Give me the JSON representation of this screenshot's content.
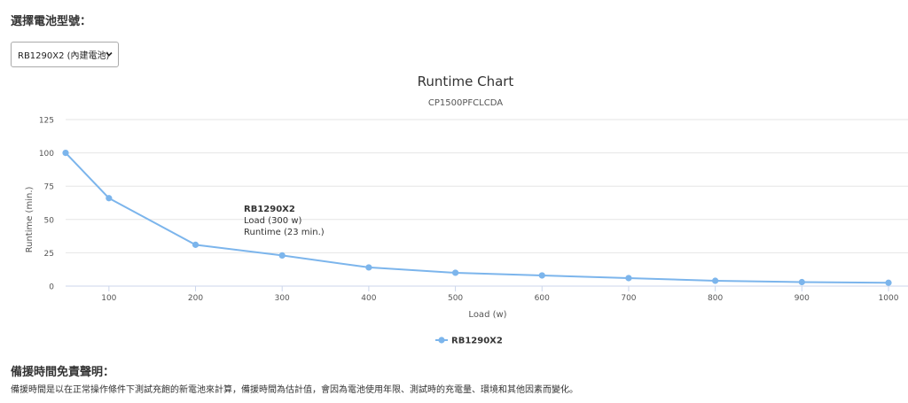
{
  "page": {
    "battery_label": "選擇電池型號：",
    "battery_select_value": "RB1290X2 (內建電池)",
    "disclaimer_title": "備援時間免責聲明：",
    "disclaimer_text": "備援時間是以在正常操作條件下測試充飽的新電池來計算，備援時間為估計值，會因為電池使用年限、測試時的充電量、環境和其他因素而變化。"
  },
  "chart_data": {
    "type": "line",
    "title": "Runtime Chart",
    "subtitle": "CP1500PFCLCDA",
    "xlabel": "Load (w)",
    "ylabel": "Runtime (min.)",
    "xlim": [
      50,
      1000
    ],
    "ylim": [
      0,
      125
    ],
    "x_ticks": [
      100,
      200,
      300,
      400,
      500,
      600,
      700,
      800,
      900,
      1000
    ],
    "y_ticks": [
      0,
      25,
      50,
      75,
      100,
      125
    ],
    "grid": true,
    "legend_position": "bottom",
    "color": "#7cb5ec",
    "series": [
      {
        "name": "RB1290X2",
        "x": [
          50,
          100,
          200,
          300,
          400,
          500,
          600,
          700,
          800,
          900,
          1000
        ],
        "values": [
          100,
          66,
          31,
          23,
          14,
          10,
          8,
          6,
          4,
          3,
          2.5
        ]
      }
    ],
    "tooltip": {
      "series": "RB1290X2",
      "line1": "Load (300 w)",
      "line2": "Runtime (23 min.)"
    }
  }
}
